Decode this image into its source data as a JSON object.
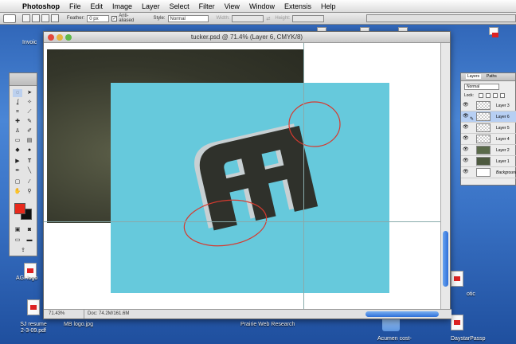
{
  "menubar": {
    "app_name": "Photoshop",
    "items": [
      "File",
      "Edit",
      "Image",
      "Layer",
      "Select",
      "Filter",
      "View",
      "Window",
      "Extensis",
      "Help"
    ]
  },
  "options": {
    "feather_label": "Feather:",
    "feather_value": "0 px",
    "antialias_label": "Anti-aliased",
    "style_label": "Style:",
    "style_value": "Normal",
    "width_label": "Width:",
    "height_label": "Height:"
  },
  "document": {
    "title": "tucker.psd @ 71.4% (Layer 6, CMYK/8)",
    "zoom": "71.43%",
    "doc_size": "Doc: 74.2M/161.6M"
  },
  "layers": {
    "tabs": [
      "Layers",
      "Paths"
    ],
    "blend_mode": "Normal",
    "lock_label": "Lock:",
    "items": [
      "Layer 3",
      "Layer 6",
      "Layer 5",
      "Layer 4",
      "Layer 2",
      "Layer 1",
      "Background"
    ],
    "selected": "Layer 6"
  },
  "desktop": {
    "icons": [
      "Invoic",
      "AGI logo",
      "SJ resume 2-3-09.pdf",
      "MB logo.jpg",
      "Prairie Web Research",
      "Acumen cost-",
      "DaystarPassp",
      "otic"
    ]
  },
  "colors": {
    "canvas_bg": "#66c9dc",
    "logo_dark": "#2f312b",
    "annotation_red": "#d63a2f",
    "foreground_swatch": "#e8291c"
  }
}
